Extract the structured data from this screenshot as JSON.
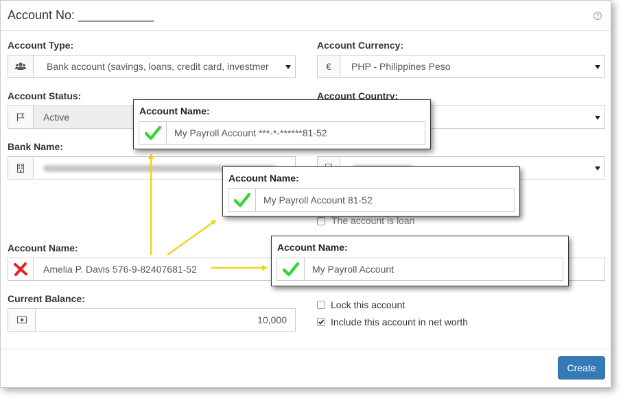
{
  "dialog": {
    "title": "Account No: ___________",
    "help_icon": "?"
  },
  "account_type": {
    "label": "Account Type:",
    "icon": "users-icon",
    "value": "Bank account (savings, loans, credit card, investmer"
  },
  "account_currency": {
    "label": "Account Currency:",
    "icon": "euro-icon",
    "icon_glyph": "€",
    "value": "PHP - Philippines Peso"
  },
  "account_status": {
    "label": "Account Status:",
    "icon": "flag-icon",
    "value": "Active"
  },
  "account_country": {
    "label": "Account Country:",
    "value": ""
  },
  "bank_name": {
    "label": "Bank Name:",
    "icon": "building-icon",
    "value": ""
  },
  "account_name": {
    "label": "Account Name:",
    "icon": "red-x-icon",
    "value": "Amelia P. Davis   576-9-82407681-52"
  },
  "current_balance": {
    "label": "Current Balance:",
    "icon": "money-icon",
    "value": "10,000"
  },
  "options": {
    "partial_checkbox_label": "The account is loan",
    "lock_label": "Lock this account",
    "lock_checked": false,
    "net_worth_label": "Include this account in net worth",
    "net_worth_checked": true
  },
  "footer": {
    "create_label": "Create"
  },
  "callouts": [
    {
      "label": "Account Name:",
      "icon": "green-check-icon",
      "value": "My Payroll Account  ***-*-******81-52"
    },
    {
      "label": "Account Name:",
      "icon": "green-check-icon",
      "value": "My Payroll Account  81-52"
    },
    {
      "label": "Account Name:",
      "icon": "green-check-icon",
      "value": "My Payroll Account"
    }
  ],
  "colors": {
    "primary_button": "#337ab7",
    "arrow": "#f2d21a",
    "check_green": "#3ad43a",
    "error_red": "#e52222"
  }
}
